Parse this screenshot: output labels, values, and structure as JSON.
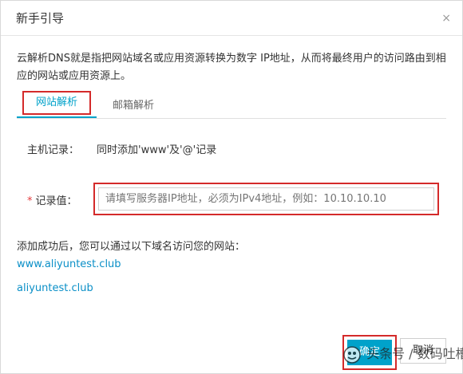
{
  "dialog": {
    "title": "新手引导",
    "close_glyph": "×"
  },
  "description": "云解析DNS就是指把网站域名或应用资源转换为数字 IP地址，从而将最终用户的访问路由到相应的网站或应用资源上。",
  "tabs": [
    {
      "label": "网站解析",
      "active": true
    },
    {
      "label": "邮箱解析",
      "active": false
    }
  ],
  "host_record": {
    "label": "主机记录：",
    "value": "同时添加'www'及'@'记录"
  },
  "record_value": {
    "required_mark": "*",
    "label": "记录值：",
    "placeholder": "请填写服务器IP地址，必须为IPv4地址，例如：10.10.10.10"
  },
  "success_text": "添加成功后，您可以通过以下域名访问您的网站：",
  "links": [
    "www.aliyuntest.club",
    "aliyuntest.club"
  ],
  "buttons": {
    "confirm": "确定",
    "cancel": "取消"
  },
  "watermark": "头条号 / 数码吐槽",
  "colors": {
    "accent": "#00a2ca",
    "highlight_border": "#d42a2a",
    "link": "#0a8fc7",
    "required": "#e4393c"
  }
}
